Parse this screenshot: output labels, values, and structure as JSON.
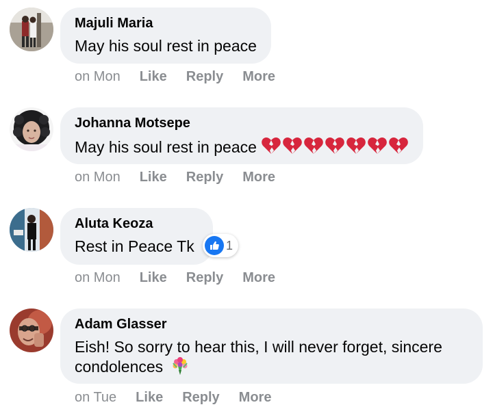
{
  "comments": [
    {
      "name": "Majuli Maria",
      "text": "May his soul rest in peace",
      "time": "on Mon",
      "actions": {
        "like": "Like",
        "reply": "Reply",
        "more": "More"
      }
    },
    {
      "name": "Johanna Motsepe",
      "text": "May his soul rest in peace",
      "emoji": "broken-heart",
      "emoji_count": 7,
      "time": "on Mon",
      "actions": {
        "like": "Like",
        "reply": "Reply",
        "more": "More"
      }
    },
    {
      "name": "Aluta Keoza",
      "text": "Rest in Peace Tk",
      "reaction": {
        "icon": "thumbs-up-icon",
        "count": "1"
      },
      "time": "on Mon",
      "actions": {
        "like": "Like",
        "reply": "Reply",
        "more": "More"
      }
    },
    {
      "name": "Adam Glasser",
      "text": "Eish! So sorry to hear this, I will never forget, sincere condolences",
      "emoji": "bouquet",
      "time": "on Tue",
      "actions": {
        "like": "Like",
        "reply": "Reply",
        "more": "More"
      }
    }
  ],
  "colors": {
    "bubble": "#eff1f4",
    "meta": "#8a8d91",
    "like_blue": "#1877f2",
    "heart_red": "#e0245e"
  }
}
